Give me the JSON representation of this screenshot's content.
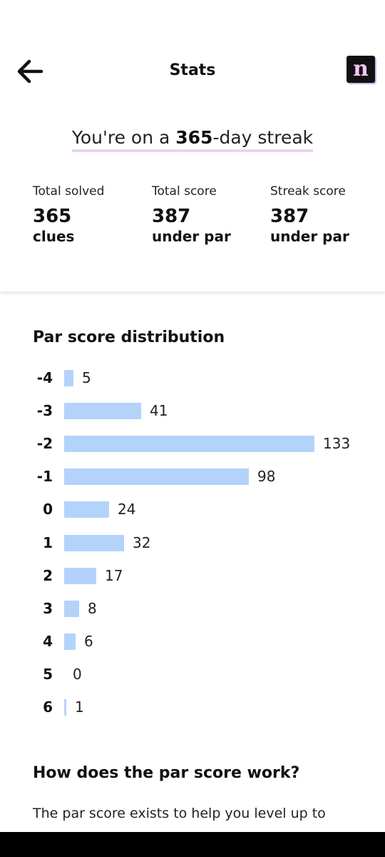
{
  "header": {
    "title": "Stats",
    "back_icon": "arrow-left-icon",
    "logo_letter": "n"
  },
  "streak": {
    "prefix": "You're on a ",
    "days": "365",
    "suffix": "-day streak"
  },
  "stats": [
    {
      "label": "Total solved",
      "value": "365",
      "unit": "clues"
    },
    {
      "label": "Total score",
      "value": "387",
      "unit": "under par"
    },
    {
      "label": "Streak score",
      "value": "387",
      "unit": "under par"
    }
  ],
  "chart_data": {
    "type": "bar",
    "title": "Par score distribution",
    "orientation": "horizontal",
    "categories": [
      "-4",
      "-3",
      "-2",
      "-1",
      "0",
      "1",
      "2",
      "3",
      "4",
      "5",
      "6"
    ],
    "values": [
      5,
      41,
      133,
      98,
      24,
      32,
      17,
      8,
      6,
      0,
      1
    ],
    "bar_color": "#b3d3fb"
  },
  "faq": {
    "title": "How does the par score work?",
    "body": "The par score exists to help you level up to"
  }
}
